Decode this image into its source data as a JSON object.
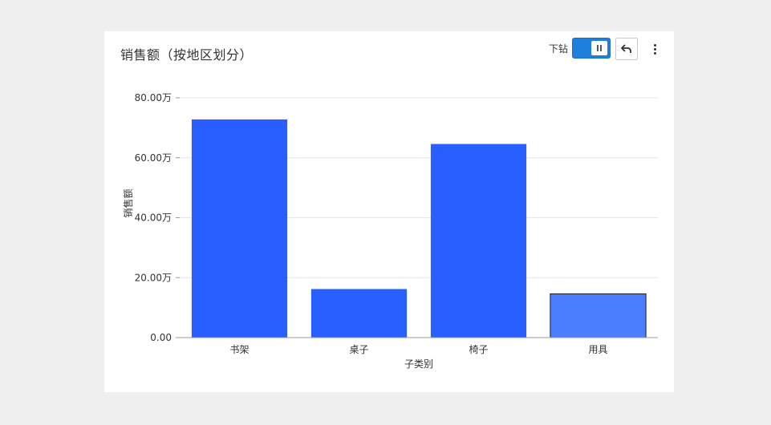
{
  "card": {
    "title": "销售额（按地区划分）",
    "drill_label": "下钻",
    "drill_enabled": true
  },
  "icons": {
    "toggle": "pause-icon",
    "back": "undo-arrow-icon",
    "more": "more-vertical-icon"
  },
  "colors": {
    "bar": "#2a5fff",
    "bar_highlight": "#4a7dff",
    "accent": "#1f7fdc"
  },
  "chart_data": {
    "type": "bar",
    "title": "",
    "xlabel": "子类别",
    "ylabel": "销售额",
    "categories": [
      "书架",
      "桌子",
      "椅子",
      "用具"
    ],
    "values": [
      728000,
      162000,
      646000,
      146000
    ],
    "ylim": [
      0,
      800000
    ],
    "yticks": [
      0,
      200000,
      400000,
      600000,
      800000
    ],
    "ytick_labels": [
      "0.00",
      "20.00万",
      "40.00万",
      "60.00万",
      "80.00万"
    ],
    "highlighted_category": "用具",
    "grid": true,
    "legend": "none"
  }
}
